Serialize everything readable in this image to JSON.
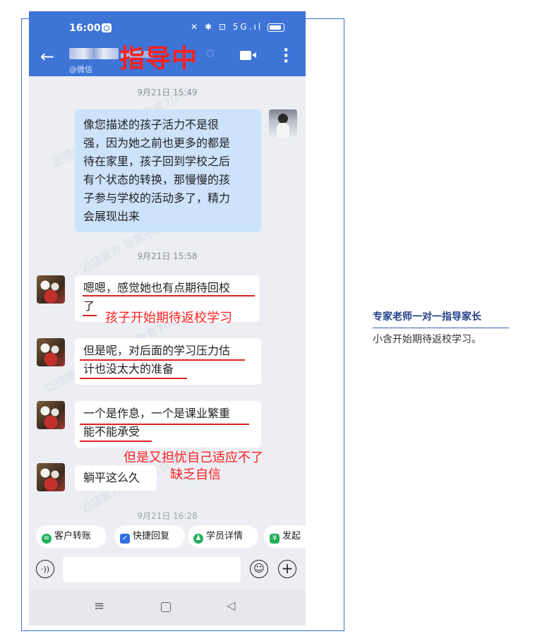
{
  "status_bar": {
    "time": "16:00",
    "icons": "✕ ✱ ⊡ 5G.ıl"
  },
  "header": {
    "contact_sub": "@微信",
    "overlay_title": "指导中",
    "ear_icon": "◌"
  },
  "watermark": "迈捷微方 百家书(百 教育7062",
  "messages": [
    {
      "timestamp": "9月21日 15:49",
      "side": "mine",
      "lines": [
        "像您描述的孩子活力不是很",
        "强，因为她之前也更多的都是",
        "待在家里，孩子回到学校之后",
        "有个状态的转换，那慢慢的孩",
        "子参与学校的活动多了，精力",
        "会展现出来"
      ]
    },
    {
      "timestamp": "9月21日 15:58"
    },
    {
      "side": "theirs",
      "lines": [
        "嗯嗯，感觉她也有点期待回校",
        "了"
      ]
    },
    {
      "side": "theirs",
      "lines": [
        "但是呢，对后面的学习压力估",
        "计也没太大的准备"
      ]
    },
    {
      "side": "theirs",
      "lines": [
        "一个是作息，一个是课业繁重",
        "能不能承受"
      ]
    },
    {
      "side": "theirs",
      "lines": [
        "躺平这么久"
      ]
    },
    {
      "timestamp": "9月21日 16:28"
    }
  ],
  "annotations": {
    "a1": "孩子开始期待返校学习",
    "a2_line1": "但是又担忧自己适应不了",
    "a2_line2": "缺乏自信"
  },
  "quick_actions": [
    {
      "label": "客户转账",
      "icon": "transfer-icon",
      "color": "#1fb15a"
    },
    {
      "label": "快捷回复",
      "icon": "quick-reply-icon",
      "color": "#2f6fe0"
    },
    {
      "label": "学员详情",
      "icon": "student-icon",
      "color": "#1fb15a"
    },
    {
      "label": "发起",
      "icon": "initiate-icon",
      "color": "#1fb15a"
    }
  ],
  "input": {
    "placeholder": ""
  },
  "caption": {
    "title": "专家老师一对一指导家长",
    "text": "小含开始期待返校学习。"
  }
}
